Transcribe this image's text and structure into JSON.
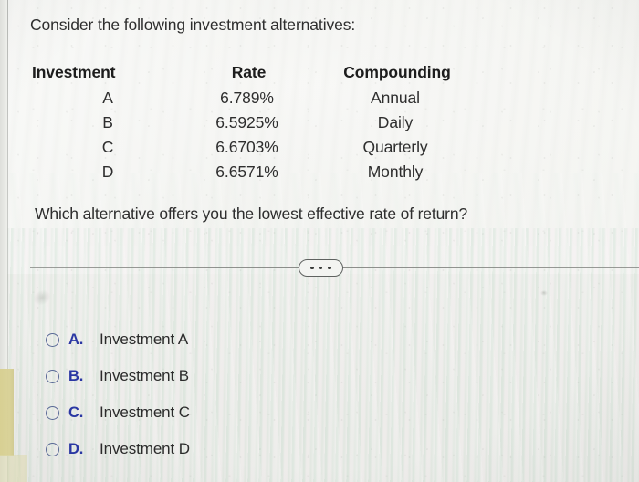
{
  "prompt": "Consider the following investment alternatives:",
  "table": {
    "headers": [
      "Investment",
      "Rate",
      "Compounding"
    ],
    "rows": [
      {
        "investment": "A",
        "rate": "6.789%",
        "compounding": "Annual"
      },
      {
        "investment": "B",
        "rate": "6.5925%",
        "compounding": "Daily"
      },
      {
        "investment": "C",
        "rate": "6.6703%",
        "compounding": "Quarterly"
      },
      {
        "investment": "D",
        "rate": "6.6571%",
        "compounding": "Monthly"
      }
    ]
  },
  "question": "Which alternative offers you the lowest effective rate of return?",
  "divider": {
    "expand_button": {
      "icon": "ellipsis-icon",
      "dots": [
        "•",
        "•",
        "•"
      ]
    }
  },
  "options": [
    {
      "letter": "A.",
      "label": "Investment A",
      "selected": false
    },
    {
      "letter": "B.",
      "label": "Investment B",
      "selected": false
    },
    {
      "letter": "C.",
      "label": "Investment C",
      "selected": false
    },
    {
      "letter": "D.",
      "label": "Investment D",
      "selected": false
    }
  ],
  "colors": {
    "option_letter": "#2a37a3",
    "radio_outline": "#5a6a96",
    "text": "#2b2b2b",
    "divider": "#7a7c78",
    "paper": "#eff0ec",
    "khaki_edge": "#d7cf8f"
  }
}
